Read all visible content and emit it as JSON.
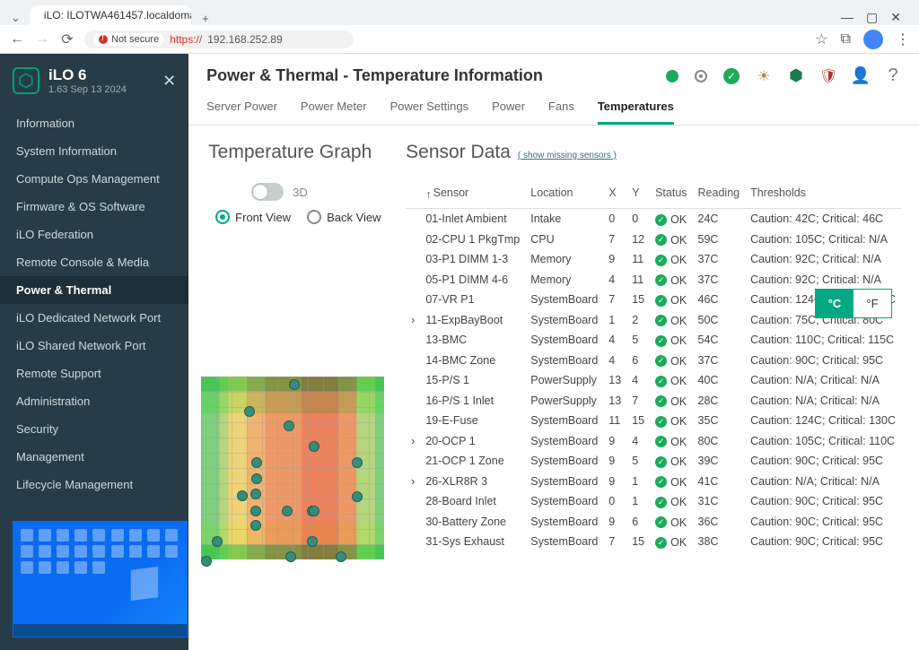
{
  "browser": {
    "tab_title": "iLO: ILOTWA461457.localdomai",
    "not_secure_label": "Not secure",
    "url_scheme": "https://",
    "url_host": "192.168.252.89",
    "new_tab_glyph": "+",
    "star_glyph": "☆",
    "ext_glyph": "⧉",
    "menu_glyph": "⋮",
    "win_min": "—",
    "win_max": "▢",
    "win_close": "✕",
    "back": "←",
    "fwd": "→",
    "reload": "⟳"
  },
  "sidebar": {
    "brand": "iLO 6",
    "version": "1.63 Sep 13 2024",
    "close_glyph": "✕",
    "items": [
      "Information",
      "System Information",
      "Compute Ops Management",
      "Firmware & OS Software",
      "iLO Federation",
      "Remote Console & Media",
      "Power & Thermal",
      "iLO Dedicated Network Port",
      "iLO Shared Network Port",
      "Remote Support",
      "Administration",
      "Security",
      "Management",
      "Lifecycle Management"
    ],
    "active_index": 6
  },
  "page": {
    "title": "Power & Thermal - Temperature Information",
    "help_glyph": "?"
  },
  "tabs": {
    "items": [
      "Server Power",
      "Power Meter",
      "Power Settings",
      "Power",
      "Fans",
      "Temperatures"
    ],
    "active_index": 5
  },
  "graph": {
    "heading": "Temperature Graph",
    "mode_3d_label": "3D",
    "front_label": "Front View",
    "back_label": "Back View",
    "selected_view": "front"
  },
  "units": {
    "celsius": "°C",
    "fahrenheit": "°F",
    "selected": "C"
  },
  "sensor_section": {
    "heading": "Sensor Data",
    "show_missing": "( show missing sensors )"
  },
  "columns": [
    "Sensor",
    "Location",
    "X",
    "Y",
    "Status",
    "Reading",
    "Thresholds"
  ],
  "ok_label": "OK",
  "expand_glyph": "›",
  "sort_glyph": "↑",
  "sensors": [
    {
      "expand": "",
      "name": "01-Inlet Ambient",
      "loc": "Intake",
      "x": "0",
      "y": "0",
      "status": "OK",
      "reading": "24C",
      "thr": "Caution: 42C; Critical: 46C"
    },
    {
      "expand": "",
      "name": "02-CPU 1 PkgTmp",
      "loc": "CPU",
      "x": "7",
      "y": "12",
      "status": "OK",
      "reading": "59C",
      "thr": "Caution: 105C; Critical: N/A"
    },
    {
      "expand": "",
      "name": "03-P1 DIMM 1-3",
      "loc": "Memory",
      "x": "9",
      "y": "11",
      "status": "OK",
      "reading": "37C",
      "thr": "Caution: 92C; Critical: N/A"
    },
    {
      "expand": "",
      "name": "05-P1 DIMM 4-6",
      "loc": "Memory",
      "x": "4",
      "y": "11",
      "status": "OK",
      "reading": "37C",
      "thr": "Caution: 92C; Critical: N/A"
    },
    {
      "expand": "",
      "name": "07-VR P1",
      "loc": "SystemBoard",
      "x": "7",
      "y": "15",
      "status": "OK",
      "reading": "46C",
      "thr": "Caution: 124C; Critical: 130C"
    },
    {
      "expand": "y",
      "name": "11-ExpBayBoot",
      "loc": "SystemBoard",
      "x": "1",
      "y": "2",
      "status": "OK",
      "reading": "50C",
      "thr": "Caution: 75C; Critical: 80C"
    },
    {
      "expand": "",
      "name": "13-BMC",
      "loc": "SystemBoard",
      "x": "4",
      "y": "5",
      "status": "OK",
      "reading": "54C",
      "thr": "Caution: 110C; Critical: 115C"
    },
    {
      "expand": "",
      "name": "14-BMC Zone",
      "loc": "SystemBoard",
      "x": "4",
      "y": "6",
      "status": "OK",
      "reading": "37C",
      "thr": "Caution: 90C; Critical: 95C"
    },
    {
      "expand": "",
      "name": "15-P/S 1",
      "loc": "PowerSupply",
      "x": "13",
      "y": "4",
      "status": "OK",
      "reading": "40C",
      "thr": "Caution: N/A; Critical: N/A"
    },
    {
      "expand": "",
      "name": "16-P/S 1 Inlet",
      "loc": "PowerSupply",
      "x": "13",
      "y": "7",
      "status": "OK",
      "reading": "28C",
      "thr": "Caution: N/A; Critical: N/A"
    },
    {
      "expand": "",
      "name": "19-E-Fuse",
      "loc": "SystemBoard",
      "x": "11",
      "y": "15",
      "status": "OK",
      "reading": "35C",
      "thr": "Caution: 124C; Critical: 130C"
    },
    {
      "expand": "y",
      "name": "20-OCP 1",
      "loc": "SystemBoard",
      "x": "9",
      "y": "4",
      "status": "OK",
      "reading": "80C",
      "thr": "Caution: 105C; Critical: 110C"
    },
    {
      "expand": "",
      "name": "21-OCP 1 Zone",
      "loc": "SystemBoard",
      "x": "9",
      "y": "5",
      "status": "OK",
      "reading": "39C",
      "thr": "Caution: 90C; Critical: 95C"
    },
    {
      "expand": "y",
      "name": "26-XLR8R 3",
      "loc": "SystemBoard",
      "x": "9",
      "y": "1",
      "status": "OK",
      "reading": "41C",
      "thr": "Caution: N/A; Critical: N/A"
    },
    {
      "expand": "",
      "name": "28-Board Inlet",
      "loc": "SystemBoard",
      "x": "0",
      "y": "1",
      "status": "OK",
      "reading": "31C",
      "thr": "Caution: 90C; Critical: 95C"
    },
    {
      "expand": "",
      "name": "30-Battery Zone",
      "loc": "SystemBoard",
      "x": "9",
      "y": "6",
      "status": "OK",
      "reading": "36C",
      "thr": "Caution: 90C; Critical: 95C"
    },
    {
      "expand": "",
      "name": "31-Sys Exhaust",
      "loc": "SystemBoard",
      "x": "7",
      "y": "15",
      "status": "OK",
      "reading": "38C",
      "thr": "Caution: 90C; Critical: 95C"
    }
  ],
  "heatmap_points": [
    [
      98,
      3
    ],
    [
      48,
      33
    ],
    [
      92,
      49
    ],
    [
      120,
      72
    ],
    [
      56,
      90
    ],
    [
      56,
      108
    ],
    [
      55,
      125
    ],
    [
      40,
      127
    ],
    [
      55,
      144
    ],
    [
      90,
      144
    ],
    [
      118,
      144
    ],
    [
      55,
      160
    ],
    [
      120,
      144
    ],
    [
      168,
      90
    ],
    [
      168,
      128
    ],
    [
      12,
      178
    ],
    [
      118,
      178
    ],
    [
      94,
      195
    ],
    [
      0,
      200
    ],
    [
      150,
      195
    ]
  ]
}
